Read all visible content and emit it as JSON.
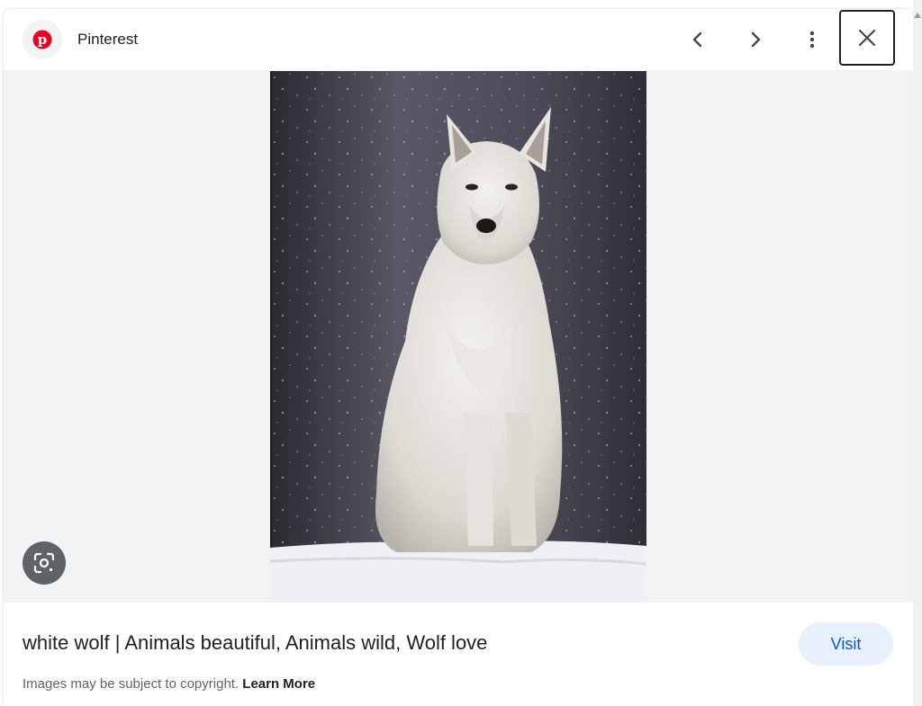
{
  "header": {
    "site_name": "Pinterest",
    "logo_icon": "pinterest-logo",
    "brand_color": "#e60023",
    "prev_icon": "chevron-left-icon",
    "next_icon": "chevron-right-icon",
    "more_icon": "more-vert-icon",
    "close_icon": "close-icon"
  },
  "main": {
    "image_subject": "white wolf sitting in snow",
    "lens_icon": "google-lens-icon"
  },
  "footer": {
    "title": "white wolf | Animals beautiful, Animals wild, Wolf love",
    "visit_label": "Visit",
    "copyright_text": "Images may be subject to copyright.",
    "learn_more_label": "Learn More"
  },
  "colors": {
    "stage_bg": "#f1f3f4",
    "visit_bg": "#e8f0fe",
    "visit_text": "#0b57d0"
  }
}
